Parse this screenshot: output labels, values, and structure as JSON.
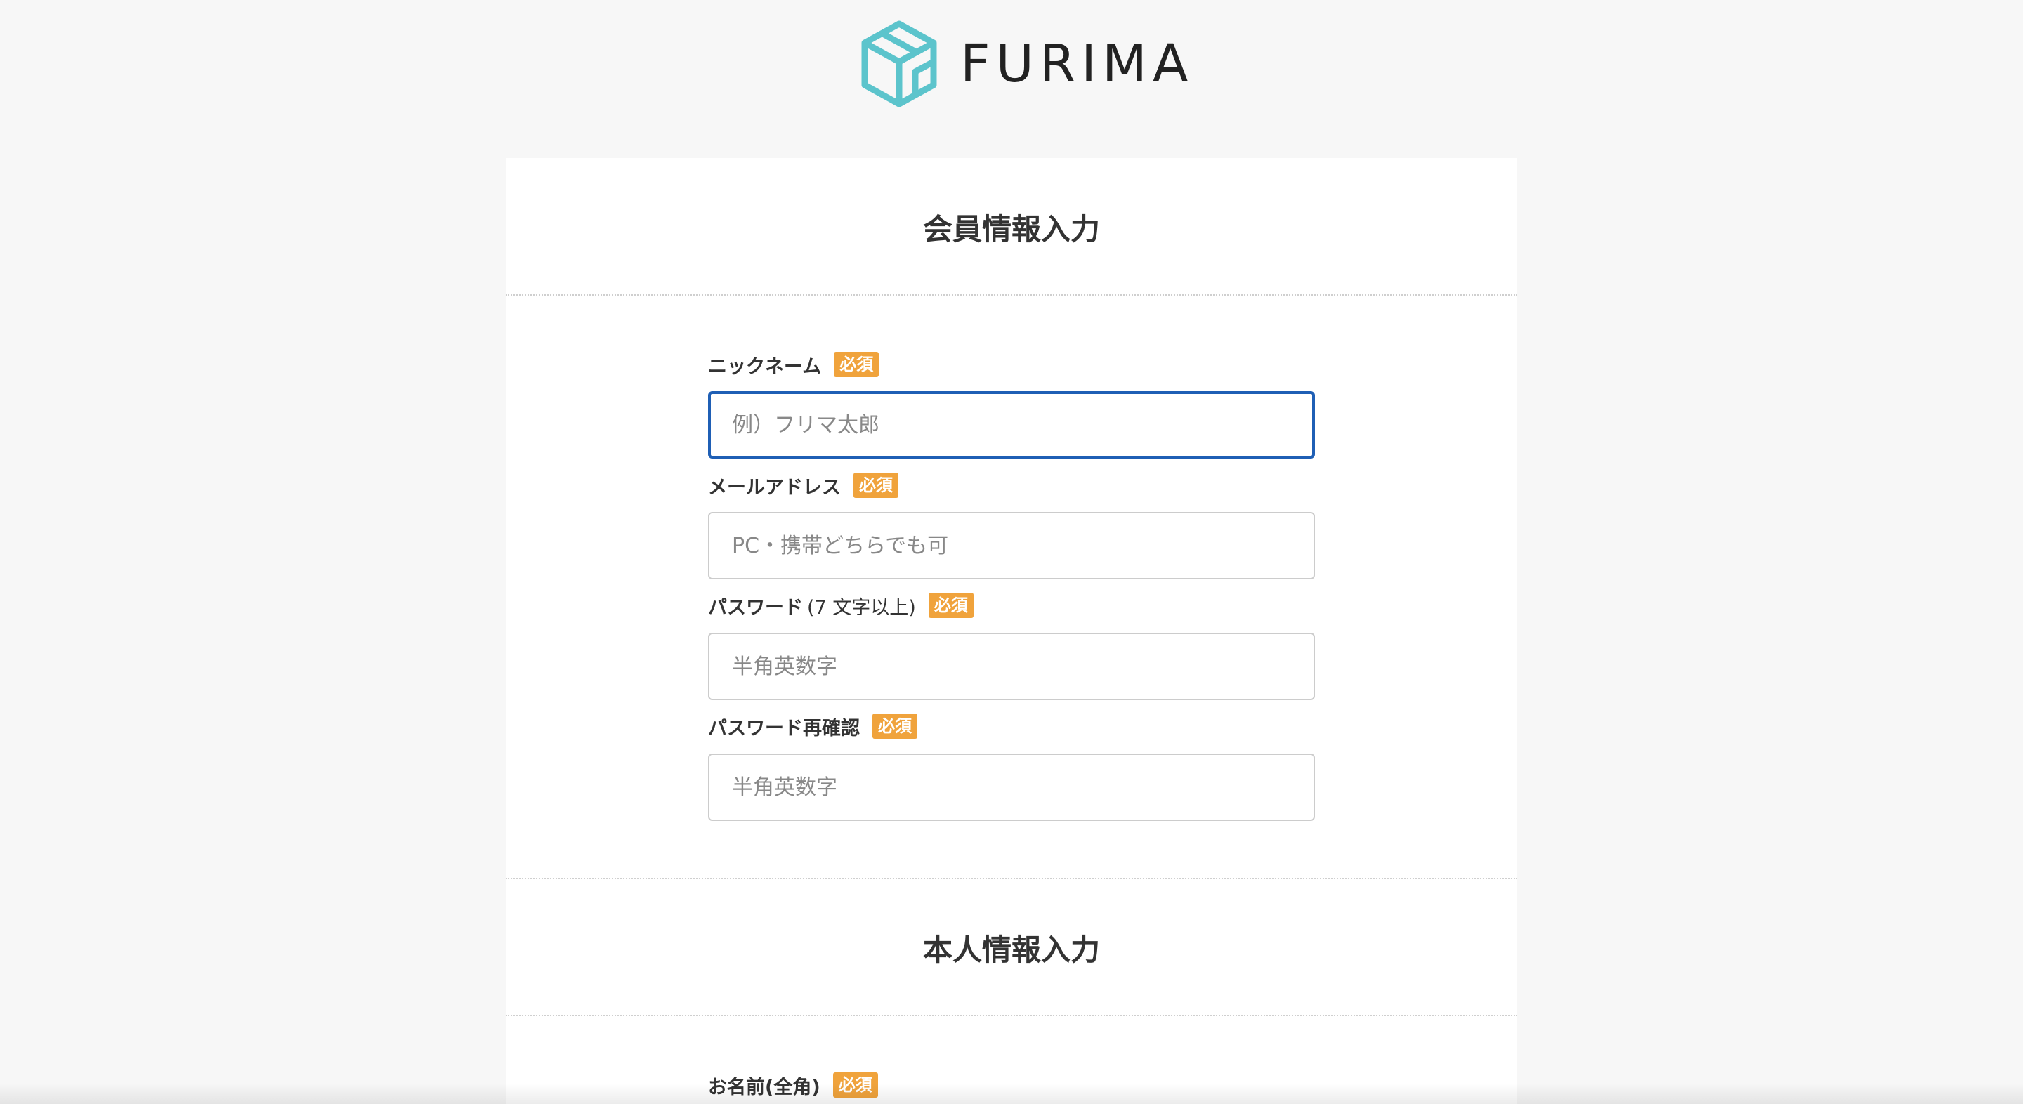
{
  "header": {
    "logo_text": "FURIMA",
    "logo_color": "#5cc4cc"
  },
  "member_section": {
    "title": "会員情報入力",
    "fields": [
      {
        "label": "ニックネーム",
        "extra": "",
        "required": "必須",
        "placeholder": "例）フリマ太郎",
        "value": "",
        "focused": true
      },
      {
        "label": "メールアドレス",
        "extra": "",
        "required": "必須",
        "placeholder": "PC・携帯どちらでも可",
        "value": ""
      },
      {
        "label": "パスワード",
        "extra": "(7 文字以上)",
        "required": "必須",
        "placeholder": "半角英数字",
        "value": ""
      },
      {
        "label": "パスワード再確認",
        "extra": "",
        "required": "必須",
        "placeholder": "半角英数字",
        "value": ""
      }
    ]
  },
  "personal_section": {
    "title": "本人情報入力",
    "fields": [
      {
        "label": "お名前(全角)",
        "required": "必須"
      }
    ]
  },
  "colors": {
    "background": "#f7f7f7",
    "required_badge": "#f0a33c",
    "focus_border": "#1f5fb5"
  }
}
